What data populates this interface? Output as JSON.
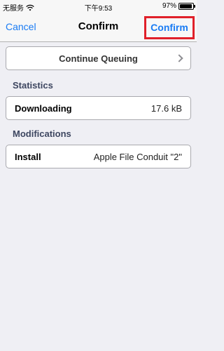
{
  "status_bar": {
    "carrier": "无服务",
    "wifi_icon": "wifi-icon",
    "time": "下午9:53",
    "battery_percent": "97%",
    "battery_level": 0.97
  },
  "nav": {
    "cancel_label": "Cancel",
    "title": "Confirm",
    "confirm_label": "Confirm"
  },
  "queue": {
    "label": "Continue Queuing",
    "chevron_icon": "chevron-right-icon"
  },
  "statistics": {
    "header": "Statistics",
    "rows": [
      {
        "label": "Downloading",
        "value": "17.6 kB"
      }
    ]
  },
  "modifications": {
    "header": "Modifications",
    "rows": [
      {
        "label": "Install",
        "value": "Apple File Conduit \"2\""
      }
    ]
  },
  "colors": {
    "accent": "#1a7cf4",
    "highlight_border": "#e0202a",
    "background": "#efeff4"
  }
}
